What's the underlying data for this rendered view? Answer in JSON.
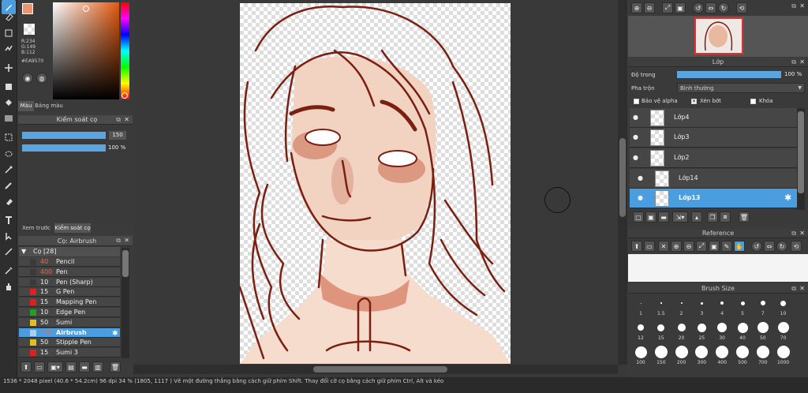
{
  "colors": {
    "primary": "#EA9570",
    "accent": "#5aa6e0",
    "canvas_line": "#7a1f12"
  },
  "color_panel": {
    "r": "R:234",
    "g": "G:149",
    "b": "B:112",
    "hex": "#EA9570",
    "tab_color": "Màu",
    "tab_palette": "Bảng màu"
  },
  "brush_control": {
    "title": "Kiểm soát cọ",
    "size_value": "150",
    "opacity_value": "100 %",
    "size_fraction": 1.0,
    "opacity_fraction": 1.0
  },
  "brush_tabs": {
    "preview": "Xem trước cọ",
    "control": "Kiểm soát cọ"
  },
  "brush_list": {
    "title": "Cọ: Airbrush",
    "group": "Cọ [28]",
    "items": [
      {
        "size": "40",
        "name": "Pencil",
        "color": "#3a3a3a",
        "size_color": "#e06a5a"
      },
      {
        "size": "400",
        "name": "Pen",
        "color": "#3a3a3a",
        "size_color": "#e06a5a"
      },
      {
        "size": "10",
        "name": "Pen (Sharp)",
        "color": "#3a3a3a",
        "size_color": "#eee"
      },
      {
        "size": "15",
        "name": "G Pen",
        "color": "#e02020",
        "size_color": "#eee"
      },
      {
        "size": "15",
        "name": "Mapping Pen",
        "color": "#e02020",
        "size_color": "#eee"
      },
      {
        "size": "10",
        "name": "Edge Pen",
        "color": "#20a020",
        "size_color": "#eee"
      },
      {
        "size": "50",
        "name": "Sumi",
        "color": "#e0c020",
        "size_color": "#eee"
      },
      {
        "size": "150",
        "name": "Airbrush",
        "color": "#aacff0",
        "size_color": "#e06a5a",
        "selected": true
      },
      {
        "size": "50",
        "name": "Stipple Pen",
        "color": "#e0c020",
        "size_color": "#eee"
      },
      {
        "size": "15",
        "name": "Sumi 3",
        "color": "#e02020",
        "size_color": "#eee"
      }
    ]
  },
  "layer_panel": {
    "title": "Lớp",
    "opacity_label": "Độ trong",
    "opacity_value": "100 %",
    "opacity_fraction": 1.0,
    "blend_label": "Pha trộn",
    "blend_value": "Bình thường",
    "protect_alpha": "Bảo vệ alpha",
    "clipping": "Xén bớt",
    "lock": "Khóa",
    "layers": [
      "Lớp4",
      "Lớp3",
      "Lớp2",
      "Lớp14",
      "Lớp13"
    ]
  },
  "reference_panel": {
    "title": "Reference"
  },
  "brush_size_panel": {
    "title": "Brush Size",
    "sizes": [
      "1",
      "1.5",
      "2",
      "3",
      "4",
      "5",
      "7",
      "10",
      "12",
      "15",
      "20",
      "25",
      "30",
      "40",
      "50",
      "70",
      "100",
      "150",
      "200",
      "300",
      "400",
      "500",
      "700",
      "1000"
    ]
  },
  "status_bar": {
    "text": "1536 * 2048 pixel  (40.6 * 54.2cm)  96 dpi  34 %  (1805, 1117 )  Vẽ một đường thẳng bằng cách giữ phím Shift. Thay đổi cỡ cọ bằng cách giữ phím Ctrl, Alt và kéo"
  }
}
